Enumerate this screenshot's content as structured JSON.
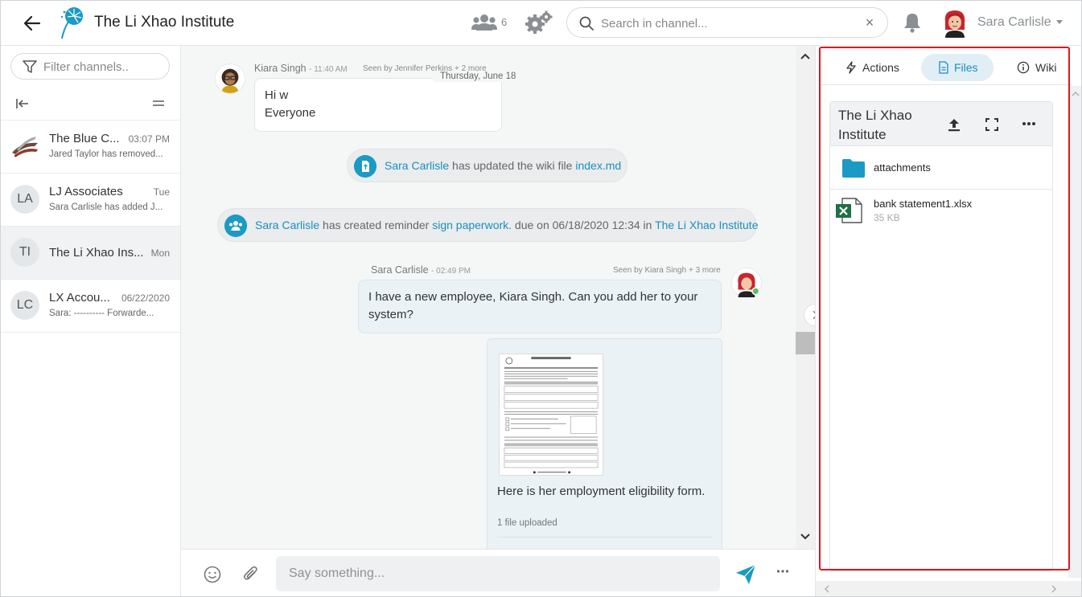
{
  "header": {
    "title": "The Li Xhao Institute",
    "members_count": "6",
    "search_placeholder": "Search in channel...",
    "clear_symbol": "×",
    "user_name": "Sara Carlisle"
  },
  "sidebar": {
    "filter_placeholder": "Filter channels..",
    "channels": [
      {
        "initials": "",
        "name": "The Blue C...",
        "time": "03:07 PM",
        "preview": "Jared Taylor has removed..."
      },
      {
        "initials": "LA",
        "name": "LJ Associates",
        "time": "Tue",
        "preview": "Sara Carlisle has added J..."
      },
      {
        "initials": "TI",
        "name": "The Li Xhao Ins...",
        "time": "Mon",
        "preview": ""
      },
      {
        "initials": "LC",
        "name": "LX Accou...",
        "time": "06/22/2020",
        "preview": "Sara: ---------- Forwarde..."
      }
    ]
  },
  "chat": {
    "msg1": {
      "sender": "Kiara Singh",
      "time": "- 11:40 AM",
      "seen": "Seen by Jennifer Perkins + 2 more",
      "lines": [
        "Hi w",
        "Everyone"
      ]
    },
    "date_divider": "Thursday, June 18",
    "sys1": {
      "actor": "Sara Carlisle",
      "text": " has updated the wiki file ",
      "target": "index.md"
    },
    "sys2": {
      "actor": "Sara Carlisle",
      "text": " has created reminder ",
      "target": "sign paperwork.",
      "text2": " due on 06/18/2020 12:34 in ",
      "target2": "The Li Xhao Institute"
    },
    "msg2": {
      "sender": "Sara Carlisle",
      "time": "- 02:49 PM",
      "seen": "Seen by Kiara Singh + 3 more",
      "text": "I have a new employee, Kiara Singh. Can you add her to your system?"
    },
    "file_msg": {
      "caption": "Here is her employment eligibility form.",
      "count": "1 file uploaded"
    }
  },
  "composer": {
    "placeholder": "Say something..."
  },
  "rpanel": {
    "tabs": [
      {
        "label": "Actions",
        "icon": "lightning-icon"
      },
      {
        "label": "Files",
        "icon": "document-icon"
      },
      {
        "label": "Wiki",
        "icon": "info-icon"
      }
    ],
    "active_tab": "Files",
    "files_title": "The Li Xhao Institute",
    "items": [
      {
        "name": "attachments",
        "type": "folder",
        "size": ""
      },
      {
        "name": "bank statement1.xlsx",
        "type": "excel",
        "size": "35 KB"
      }
    ]
  },
  "colors": {
    "accent": "#1a8fbf",
    "active_tab_bg": "#e1eef5",
    "highlight": "#e0161e",
    "folder": "#1a9ac4",
    "excel": "#1e7145"
  }
}
